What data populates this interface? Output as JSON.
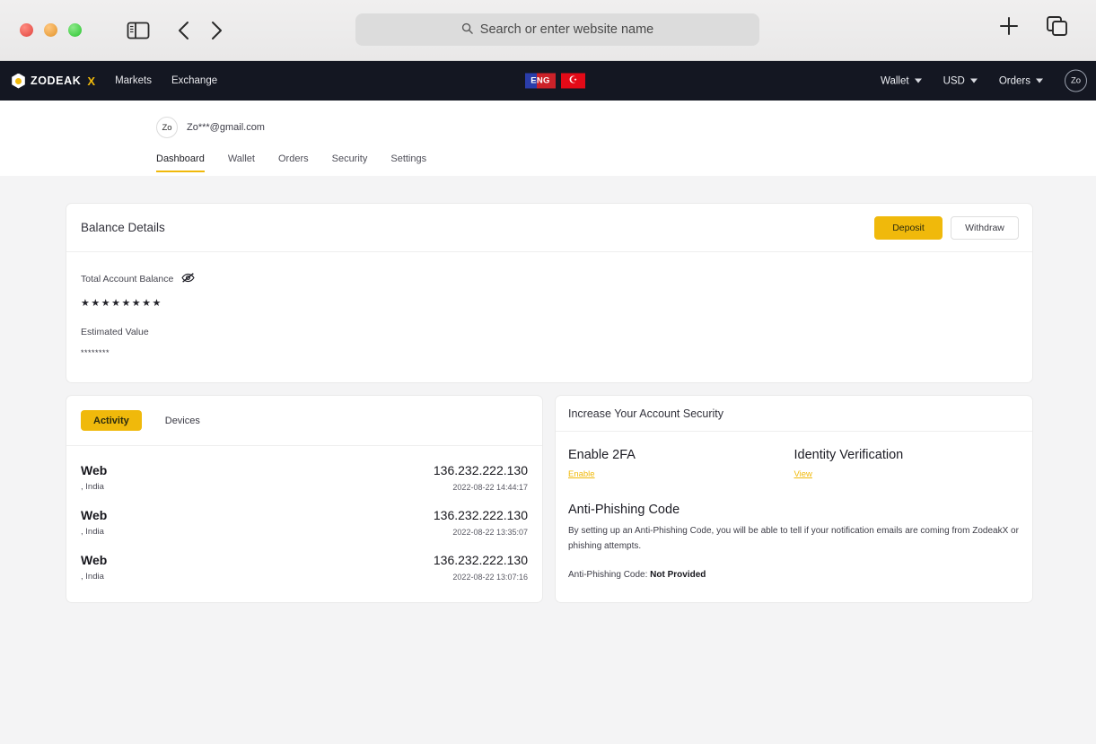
{
  "browser": {
    "sidebar_icon": "sidebar-toggle-icon",
    "back_icon": "back-arrow-icon",
    "forward_icon": "forward-arrow-icon",
    "search_placeholder": "Search or enter website name",
    "search_icon": "search-icon",
    "new_tab_icon": "plus-icon",
    "tab_overview_icon": "tab-overview-icon"
  },
  "site_nav": {
    "brand": "ZODEAK",
    "brand_suffix": "X",
    "links": [
      {
        "label": "Markets"
      },
      {
        "label": "Exchange"
      }
    ],
    "lang_badge": "ENG",
    "flag_badge": "☪",
    "menus": [
      {
        "label": "Wallet"
      },
      {
        "label": "USD"
      },
      {
        "label": "Orders"
      }
    ],
    "avatar": "Zo"
  },
  "account": {
    "avatar": "Zo",
    "email": "Zo***@gmail.com",
    "tabs": [
      {
        "label": "Dashboard",
        "active": true
      },
      {
        "label": "Wallet",
        "active": false
      },
      {
        "label": "Orders",
        "active": false
      },
      {
        "label": "Security",
        "active": false
      },
      {
        "label": "Settings",
        "active": false
      }
    ]
  },
  "balance": {
    "title": "Balance Details",
    "deposit_label": "Deposit",
    "withdraw_label": "Withdraw",
    "total_label": "Total Account Balance",
    "visibility_icon": "eye-off-icon",
    "total_value": "★★★★★★★★",
    "estimated_label": "Estimated Value",
    "estimated_value": "********"
  },
  "activity": {
    "tabs": [
      {
        "label": "Activity",
        "active": true
      },
      {
        "label": "Devices",
        "active": false
      }
    ],
    "rows": [
      {
        "device": "Web",
        "location": ", India",
        "ip": "136.232.222.130",
        "time": "2022-08-22 14:44:17"
      },
      {
        "device": "Web",
        "location": ", India",
        "ip": "136.232.222.130",
        "time": "2022-08-22 13:35:07"
      },
      {
        "device": "Web",
        "location": ", India",
        "ip": "136.232.222.130",
        "time": "2022-08-22 13:07:16"
      }
    ]
  },
  "security": {
    "title": "Increase Your Account Security",
    "twofa_title": "Enable 2FA",
    "twofa_link": "Enable",
    "identity_title": "Identity Verification",
    "identity_link": "View",
    "antiphish_title": "Anti-Phishing Code",
    "antiphish_desc": "By setting up an Anti-Phishing Code, you will be able to tell if your notification emails are coming from ZodeakX or phishing attempts.",
    "antiphish_status_label": "Anti-Phishing Code: ",
    "antiphish_status_value": "Not Provided"
  },
  "colors": {
    "accent": "#f0b90b",
    "nav_bg": "#141722",
    "page_bg": "#f4f4f5"
  }
}
